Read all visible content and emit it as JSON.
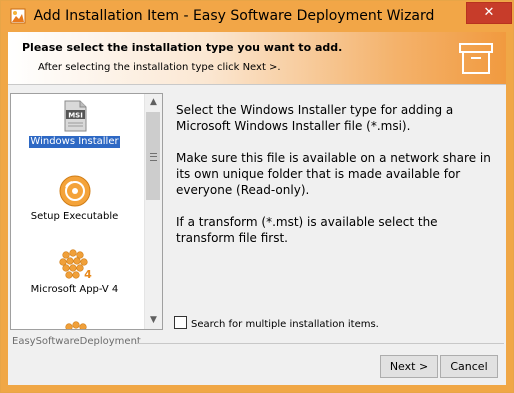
{
  "window": {
    "title": "Add Installation Item - Easy Software Deployment Wizard",
    "close_label": "✕",
    "frame_color": "#f2a647"
  },
  "header": {
    "title": "Please select the installation type you want to add.",
    "subtitle": "After selecting the installation type click Next >.",
    "icon": "archive-box-icon"
  },
  "types": [
    {
      "label": "Windows Installer",
      "icon": "msi-file-icon",
      "selected": true
    },
    {
      "label": "Setup Executable",
      "icon": "setup-disc-icon",
      "selected": false
    },
    {
      "label": "Microsoft App-V 4",
      "icon": "appv4-cubes-icon",
      "selected": false
    }
  ],
  "description": {
    "p1": "Select the Windows Installer type for adding a Microsoft Windows Installer file (*.msi).",
    "p2": "Make sure this file is available on a network share in its own unique folder that is made available for everyone (Read-only).",
    "p3": "If a transform (*.mst) is available select the transform file first."
  },
  "options": {
    "multi_search_label": "Search for multiple installation items.",
    "multi_search_checked": false
  },
  "footer": {
    "brand": "EasySoftwareDeployment",
    "next_label": "Next >",
    "cancel_label": "Cancel"
  },
  "colors": {
    "accent": "#f19a3f",
    "selection": "#2d68c4"
  }
}
